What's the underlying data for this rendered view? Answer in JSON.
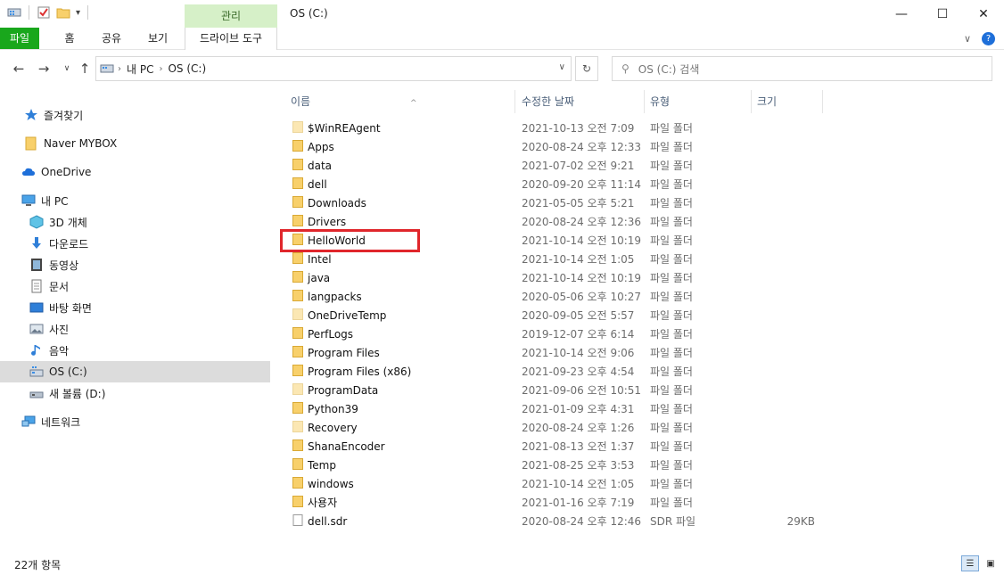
{
  "window": {
    "title": "OS (C:)",
    "context_tab_group": "관리",
    "minimize": "—",
    "maximize": "☐",
    "close": "✕"
  },
  "ribbon": {
    "tabs": [
      "파일",
      "홈",
      "공유",
      "보기"
    ],
    "context_tab": "드라이브 도구",
    "file_tab_color": "#19a71c"
  },
  "address": {
    "crumbs": [
      "내 PC",
      "OS (C:)"
    ],
    "search_placeholder": "OS (C:) 검색"
  },
  "nav": {
    "items": [
      {
        "label": "즐겨찾기",
        "icon": "star-icon"
      },
      {
        "label": "Naver MYBOX",
        "icon": "folder-icon"
      },
      {
        "label": "OneDrive",
        "icon": "cloud-icon"
      },
      {
        "label": "내 PC",
        "icon": "computer-icon"
      },
      {
        "label": "3D 개체",
        "icon": "cube-icon"
      },
      {
        "label": "다운로드",
        "icon": "download-icon"
      },
      {
        "label": "동영상",
        "icon": "video-icon"
      },
      {
        "label": "문서",
        "icon": "document-icon"
      },
      {
        "label": "바탕 화면",
        "icon": "desktop-icon"
      },
      {
        "label": "사진",
        "icon": "picture-icon"
      },
      {
        "label": "음악",
        "icon": "music-icon"
      },
      {
        "label": "OS (C:)",
        "icon": "drive-c-icon"
      },
      {
        "label": "새 볼륨 (D:)",
        "icon": "drive-d-icon"
      },
      {
        "label": "네트워크",
        "icon": "network-icon"
      }
    ]
  },
  "columns": {
    "name": "이름",
    "date": "수정한 날짜",
    "type": "유형",
    "size": "크기"
  },
  "files": [
    {
      "name": "$WinREAgent",
      "date": "2021-10-13 오전 7:09",
      "type": "파일 폴더",
      "size": "",
      "kind": "folder-faint"
    },
    {
      "name": "Apps",
      "date": "2020-08-24 오후 12:33",
      "type": "파일 폴더",
      "size": "",
      "kind": "folder"
    },
    {
      "name": "data",
      "date": "2021-07-02 오전 9:21",
      "type": "파일 폴더",
      "size": "",
      "kind": "folder"
    },
    {
      "name": "dell",
      "date": "2020-09-20 오후 11:14",
      "type": "파일 폴더",
      "size": "",
      "kind": "folder"
    },
    {
      "name": "Downloads",
      "date": "2021-05-05 오후 5:21",
      "type": "파일 폴더",
      "size": "",
      "kind": "folder"
    },
    {
      "name": "Drivers",
      "date": "2020-08-24 오후 12:36",
      "type": "파일 폴더",
      "size": "",
      "kind": "folder"
    },
    {
      "name": "HelloWorld",
      "date": "2021-10-14 오전 10:19",
      "type": "파일 폴더",
      "size": "",
      "kind": "folder"
    },
    {
      "name": "Intel",
      "date": "2021-10-14 오전 1:05",
      "type": "파일 폴더",
      "size": "",
      "kind": "folder"
    },
    {
      "name": "java",
      "date": "2021-10-14 오전 10:19",
      "type": "파일 폴더",
      "size": "",
      "kind": "folder"
    },
    {
      "name": "langpacks",
      "date": "2020-05-06 오후 10:27",
      "type": "파일 폴더",
      "size": "",
      "kind": "folder"
    },
    {
      "name": "OneDriveTemp",
      "date": "2020-09-05 오전 5:57",
      "type": "파일 폴더",
      "size": "",
      "kind": "folder-faint"
    },
    {
      "name": "PerfLogs",
      "date": "2019-12-07 오후 6:14",
      "type": "파일 폴더",
      "size": "",
      "kind": "folder"
    },
    {
      "name": "Program Files",
      "date": "2021-10-14 오전 9:06",
      "type": "파일 폴더",
      "size": "",
      "kind": "folder"
    },
    {
      "name": "Program Files (x86)",
      "date": "2021-09-23 오후 4:54",
      "type": "파일 폴더",
      "size": "",
      "kind": "folder"
    },
    {
      "name": "ProgramData",
      "date": "2021-09-06 오전 10:51",
      "type": "파일 폴더",
      "size": "",
      "kind": "folder-faint"
    },
    {
      "name": "Python39",
      "date": "2021-01-09 오후 4:31",
      "type": "파일 폴더",
      "size": "",
      "kind": "folder"
    },
    {
      "name": "Recovery",
      "date": "2020-08-24 오후 1:26",
      "type": "파일 폴더",
      "size": "",
      "kind": "folder-faint"
    },
    {
      "name": "ShanaEncoder",
      "date": "2021-08-13 오전 1:37",
      "type": "파일 폴더",
      "size": "",
      "kind": "folder"
    },
    {
      "name": "Temp",
      "date": "2021-08-25 오후 3:53",
      "type": "파일 폴더",
      "size": "",
      "kind": "folder"
    },
    {
      "name": "windows",
      "date": "2021-10-14 오전 1:05",
      "type": "파일 폴더",
      "size": "",
      "kind": "folder"
    },
    {
      "name": "사용자",
      "date": "2021-01-16 오후 7:19",
      "type": "파일 폴더",
      "size": "",
      "kind": "folder"
    },
    {
      "name": "dell.sdr",
      "date": "2020-08-24 오후 12:46",
      "type": "SDR 파일",
      "size": "29KB",
      "kind": "file"
    }
  ],
  "status": {
    "item_count": "22개 항목"
  },
  "colors": {
    "highlight_box": "#e0262b",
    "folder": "#f8d06b",
    "selected_nav": "#dcdcdc"
  }
}
